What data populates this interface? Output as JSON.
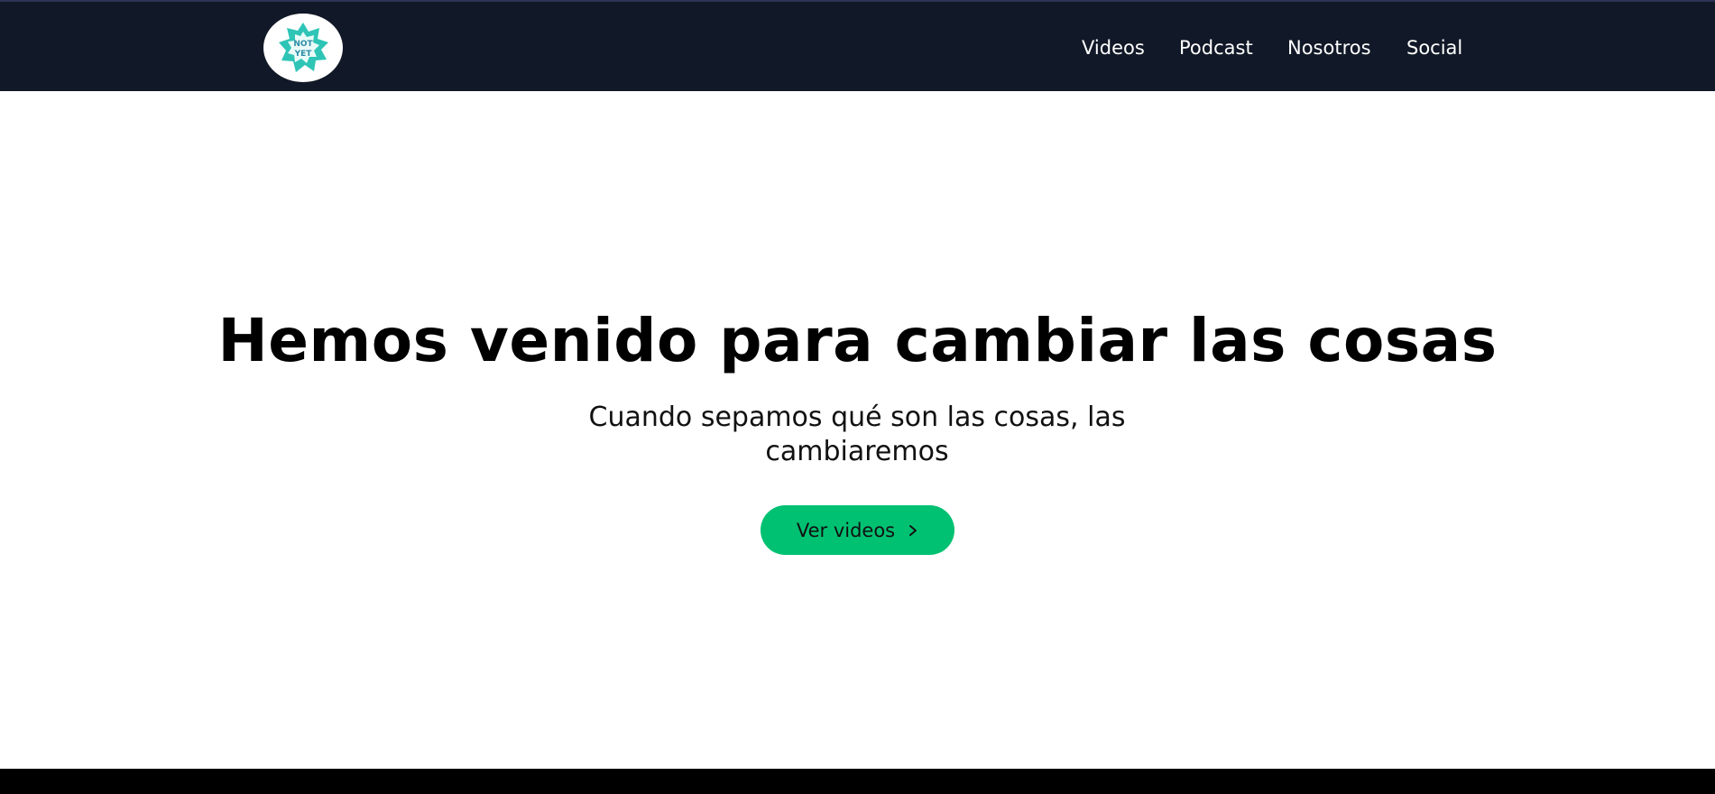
{
  "header": {
    "logo": {
      "text_line1": "NOT",
      "text_line2": "YET",
      "color": "#2ec4b6"
    },
    "nav": [
      {
        "label": "Videos"
      },
      {
        "label": "Podcast"
      },
      {
        "label": "Nosotros"
      },
      {
        "label": "Social"
      }
    ],
    "background": "#111827"
  },
  "hero": {
    "title": "Hemos venido para cambiar las cosas",
    "subtitle": "Cuando sepamos qué son las cosas, las cambiaremos",
    "cta": {
      "label": "Ver videos",
      "icon": "chevron-right-icon",
      "color": "#00c172"
    }
  }
}
